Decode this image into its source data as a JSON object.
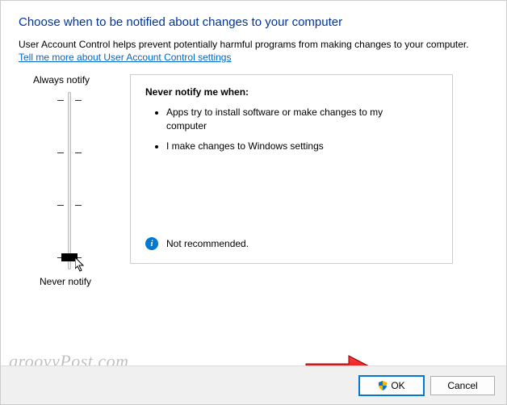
{
  "title": "Choose when to be notified about changes to your computer",
  "subtitle": "User Account Control helps prevent potentially harmful programs from making changes to your computer.",
  "link": "Tell me more about User Account Control settings",
  "slider": {
    "top_label": "Always notify",
    "bottom_label": "Never notify"
  },
  "description": {
    "heading": "Never notify me when:",
    "items": [
      "Apps try to install software or make changes to my computer",
      "I make changes to Windows settings"
    ],
    "recommendation": "Not recommended."
  },
  "buttons": {
    "ok": "OK",
    "cancel": "Cancel"
  },
  "watermark": "groovyPost.com"
}
